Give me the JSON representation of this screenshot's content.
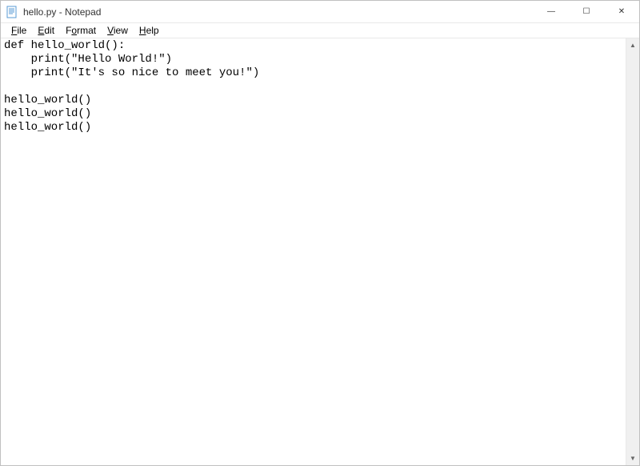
{
  "titlebar": {
    "filename": "hello.py",
    "separator": " - ",
    "appname": "Notepad"
  },
  "menubar": {
    "file": "File",
    "edit": "Edit",
    "format": "Format",
    "view": "View",
    "help": "Help"
  },
  "editor": {
    "content": "def hello_world():\n    print(\"Hello World!\")\n    print(\"It's so nice to meet you!\")\n\nhello_world()\nhello_world()\nhello_world()"
  },
  "icons": {
    "minimize": "—",
    "maximize": "☐",
    "close": "✕",
    "scroll_up": "▲",
    "scroll_down": "▼"
  }
}
